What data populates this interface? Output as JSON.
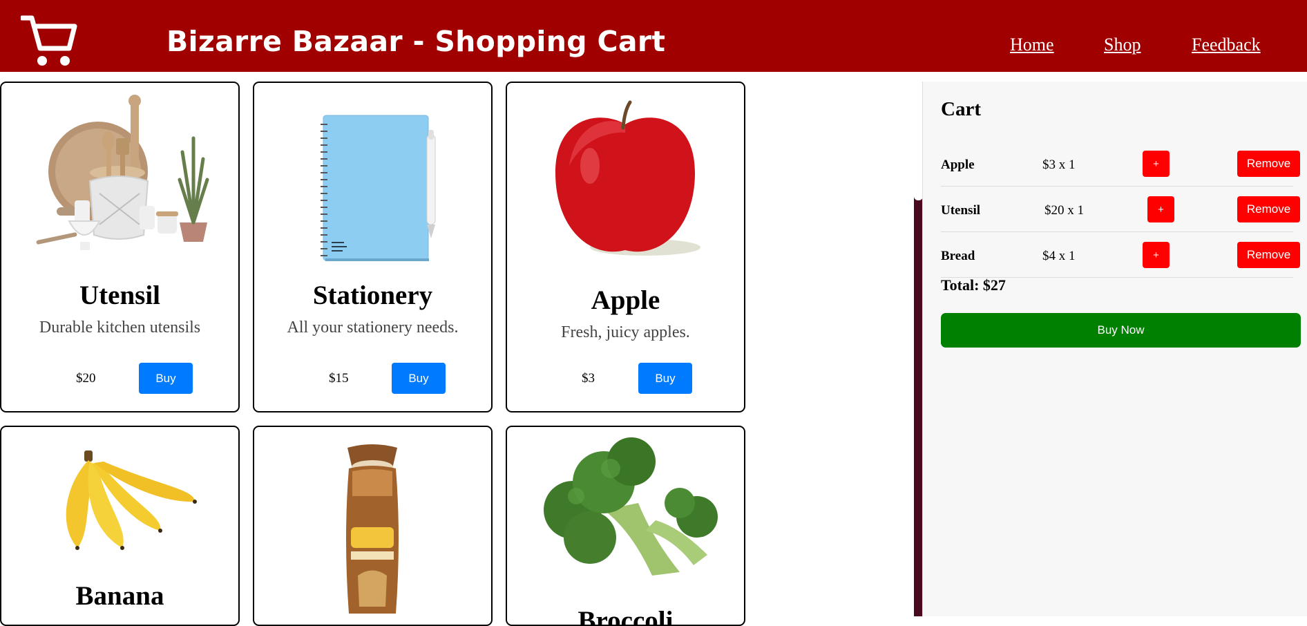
{
  "header": {
    "title": "Bizarre Bazaar - Shopping Cart",
    "logo_icon": "shopping-cart-icon",
    "nav": [
      "Home",
      "Shop",
      "Feedback"
    ],
    "background_color": "#a00000"
  },
  "products": [
    {
      "name": "Utensil",
      "description": "Durable kitchen utensils",
      "price": "$20",
      "buy_label": "Buy",
      "image_icon": "kitchen-utensils-image"
    },
    {
      "name": "Stationery",
      "description": "All your stationery needs.",
      "price": "$15",
      "buy_label": "Buy",
      "image_icon": "notebook-pen-image"
    },
    {
      "name": "Apple",
      "description": "Fresh, juicy apples.",
      "price": "$3",
      "buy_label": "Buy",
      "image_icon": "apple-image"
    },
    {
      "name": "Banana",
      "image_icon": "banana-image"
    },
    {
      "name": "",
      "image_icon": "bread-loaf-image"
    },
    {
      "name": "Broccoli",
      "image_icon": "broccoli-image"
    }
  ],
  "cart": {
    "title": "Cart",
    "items": [
      {
        "name": "Apple",
        "qty": "$3 x 1",
        "plus": "+",
        "remove": "Remove"
      },
      {
        "name": "Utensil",
        "qty": "$20 x 1",
        "plus": "+",
        "remove": "Remove"
      },
      {
        "name": "Bread",
        "qty": "$4 x 1",
        "plus": "+",
        "remove": "Remove"
      }
    ],
    "total": "Total: $27",
    "buy_now": "Buy Now"
  },
  "colors": {
    "buy_button": "#007bff",
    "remove_button": "#ff0000",
    "buy_now_button": "#008000"
  }
}
